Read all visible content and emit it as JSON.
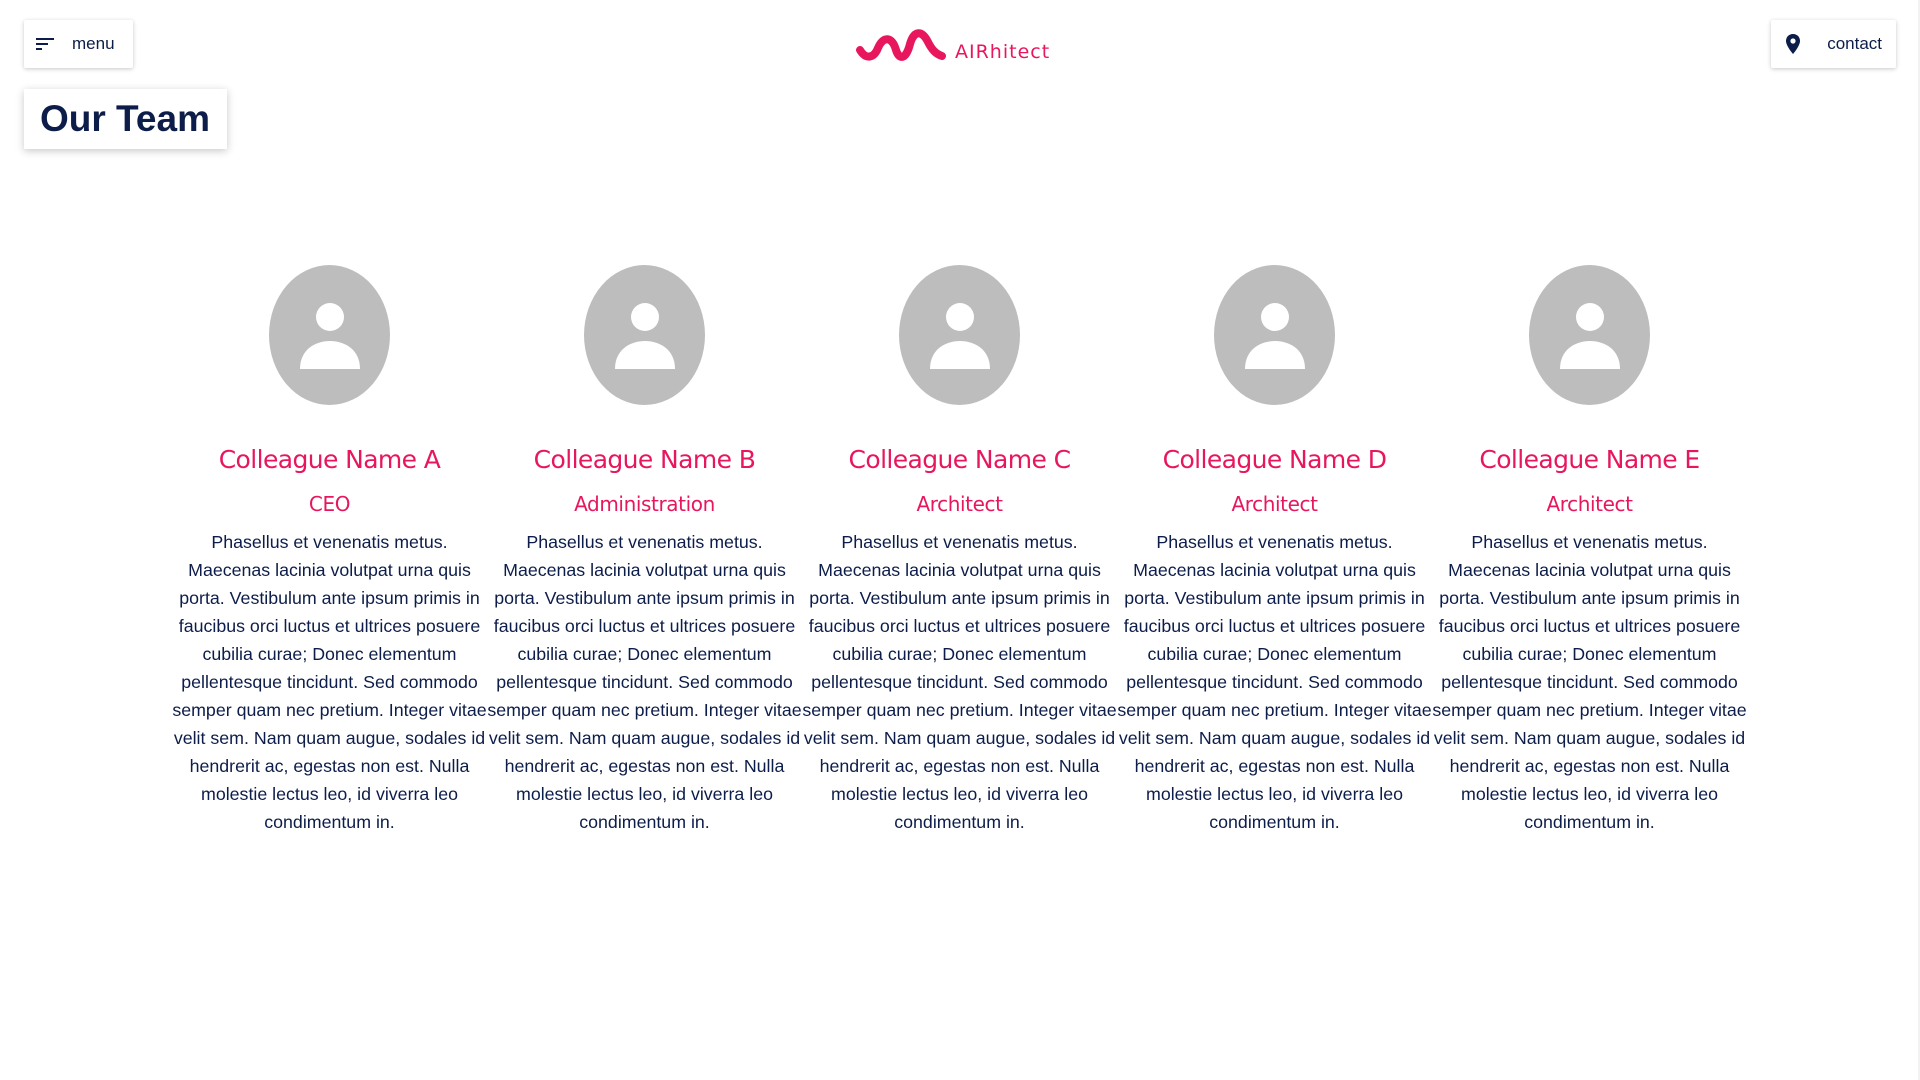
{
  "header": {
    "menu_label": "menu",
    "menu_icon": "sort-icon",
    "logo_text": "AIRhitect",
    "logo_icon": "wave-logo",
    "contact_label": "contact",
    "contact_icon": "location-pin-icon"
  },
  "page": {
    "title": "Our Team"
  },
  "colors": {
    "accent": "#e8175d",
    "navy": "#0d1d4a",
    "avatar_gray": "#bdbdbd"
  },
  "team": [
    {
      "name": "Colleague Name A",
      "role": "CEO",
      "bio": "Phasellus et venenatis metus. Maecenas lacinia volutpat urna quis porta. Vestibulum ante ipsum primis in faucibus orci luctus et ultrices posuere cubilia curae; Donec elementum pellentesque tincidunt. Sed commodo semper quam nec pretium. Integer vitae velit sem. Nam quam augue, sodales id hendrerit ac, egestas non est. Nulla molestie lectus leo, id viverra leo condimentum in."
    },
    {
      "name": "Colleague Name B",
      "role": "Administration",
      "bio": "Phasellus et venenatis metus. Maecenas lacinia volutpat urna quis porta. Vestibulum ante ipsum primis in faucibus orci luctus et ultrices posuere cubilia curae; Donec elementum pellentesque tincidunt. Sed commodo semper quam nec pretium. Integer vitae velit sem. Nam quam augue, sodales id hendrerit ac, egestas non est. Nulla molestie lectus leo, id viverra leo condimentum in."
    },
    {
      "name": "Colleague Name C",
      "role": "Architect",
      "bio": "Phasellus et venenatis metus. Maecenas lacinia volutpat urna quis porta. Vestibulum ante ipsum primis in faucibus orci luctus et ultrices posuere cubilia curae; Donec elementum pellentesque tincidunt. Sed commodo semper quam nec pretium. Integer vitae velit sem. Nam quam augue, sodales id hendrerit ac, egestas non est. Nulla molestie lectus leo, id viverra leo condimentum in."
    },
    {
      "name": "Colleague Name D",
      "role": "Architect",
      "bio": "Phasellus et venenatis metus. Maecenas lacinia volutpat urna quis porta. Vestibulum ante ipsum primis in faucibus orci luctus et ultrices posuere cubilia curae; Donec elementum pellentesque tincidunt. Sed commodo semper quam nec pretium. Integer vitae velit sem. Nam quam augue, sodales id hendrerit ac, egestas non est. Nulla molestie lectus leo, id viverra leo condimentum in."
    },
    {
      "name": "Colleague Name E",
      "role": "Architect",
      "bio": "Phasellus et venenatis metus. Maecenas lacinia volutpat urna quis porta. Vestibulum ante ipsum primis in faucibus orci luctus et ultrices posuere cubilia curae; Donec elementum pellentesque tincidunt. Sed commodo semper quam nec pretium. Integer vitae velit sem. Nam quam augue, sodales id hendrerit ac, egestas non est. Nulla molestie lectus leo, id viverra leo condimentum in."
    }
  ]
}
